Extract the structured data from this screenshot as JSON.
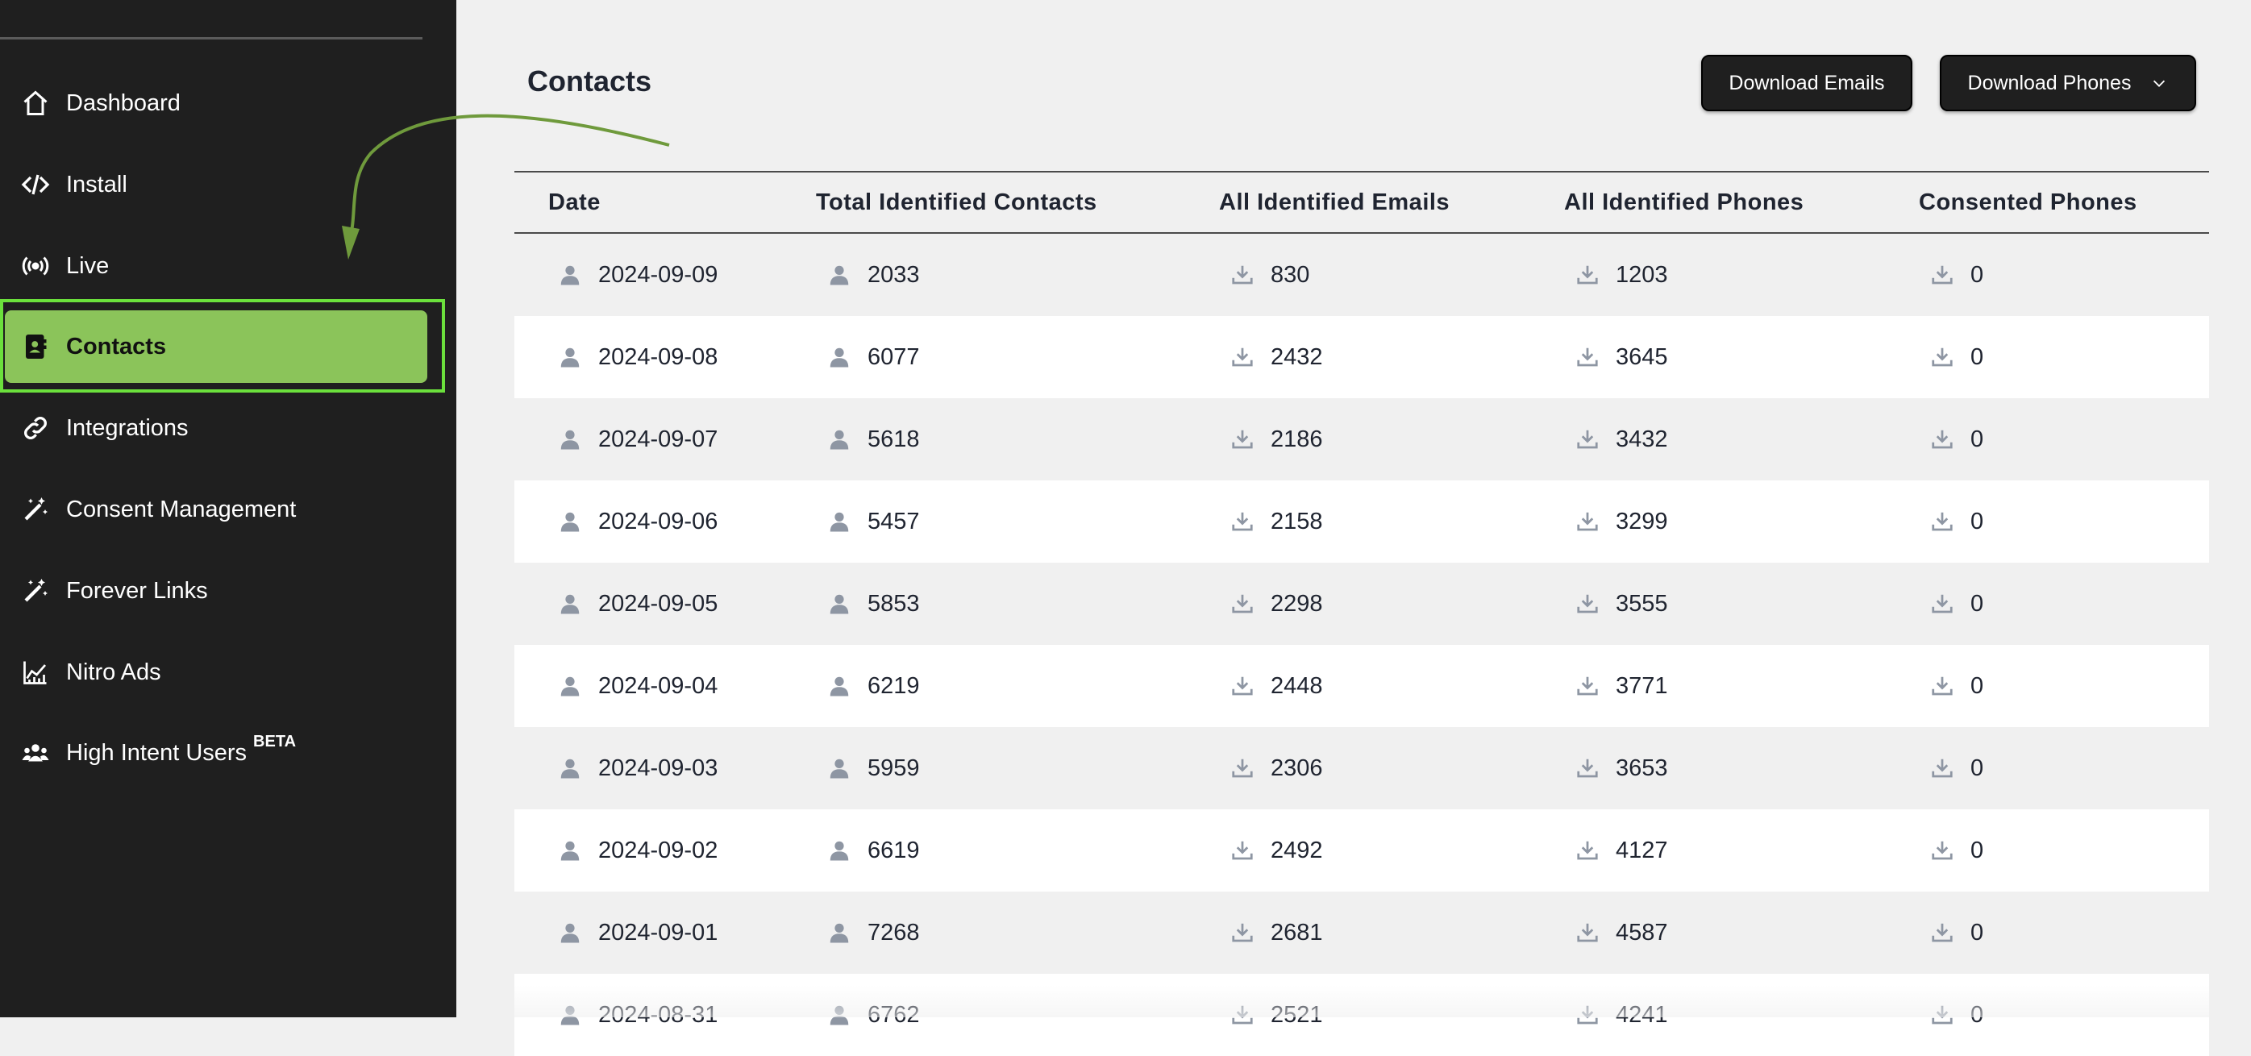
{
  "sidebar": {
    "items": [
      {
        "label": "Dashboard",
        "icon": "home-icon"
      },
      {
        "label": "Install",
        "icon": "code-icon"
      },
      {
        "label": "Live",
        "icon": "broadcast-icon"
      },
      {
        "label": "Contacts",
        "icon": "contact-book-icon",
        "active": true
      },
      {
        "label": "Integrations",
        "icon": "link-icon"
      },
      {
        "label": "Consent Management",
        "icon": "magic-wand-icon"
      },
      {
        "label": "Forever Links",
        "icon": "magic-wand-icon"
      },
      {
        "label": "Nitro Ads",
        "icon": "chart-icon"
      },
      {
        "label": "High Intent Users",
        "icon": "users-icon",
        "badge": "BETA"
      }
    ]
  },
  "page": {
    "title": "Contacts",
    "download_emails_label": "Download Emails",
    "download_phones_label": "Download Phones"
  },
  "table": {
    "headers": [
      "Date",
      "Total Identified Contacts",
      "All Identified Emails",
      "All Identified Phones",
      "Consented Phones"
    ],
    "rows": [
      [
        "2024-09-09",
        "2033",
        "830",
        "1203",
        "0"
      ],
      [
        "2024-09-08",
        "6077",
        "2432",
        "3645",
        "0"
      ],
      [
        "2024-09-07",
        "5618",
        "2186",
        "3432",
        "0"
      ],
      [
        "2024-09-06",
        "5457",
        "2158",
        "3299",
        "0"
      ],
      [
        "2024-09-05",
        "5853",
        "2298",
        "3555",
        "0"
      ],
      [
        "2024-09-04",
        "6219",
        "2448",
        "3771",
        "0"
      ],
      [
        "2024-09-03",
        "5959",
        "2306",
        "3653",
        "0"
      ],
      [
        "2024-09-02",
        "6619",
        "2492",
        "4127",
        "0"
      ],
      [
        "2024-09-01",
        "7268",
        "2681",
        "4587",
        "0"
      ],
      [
        "2024-08-31",
        "6762",
        "2521",
        "4241",
        "0"
      ]
    ]
  },
  "colors": {
    "sidebar_bg": "#1f1f1f",
    "active_bg": "#8bc45a",
    "active_outline": "#6be03c",
    "annotation_arrow": "#6f9a3c"
  }
}
